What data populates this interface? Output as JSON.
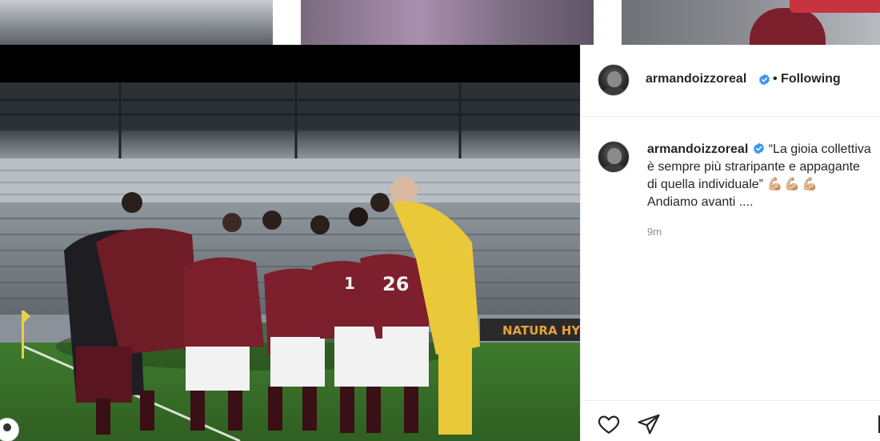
{
  "post": {
    "author": {
      "username": "armandoizzoreal",
      "verified": true,
      "follow_status": "• Following"
    },
    "caption": {
      "username": "armandoizzoreal",
      "lines": [
        "“La gioia collettiva",
        "è sempre più straripante e appagante",
        "di quella individuale”",
        "Andiamo avanti ...."
      ],
      "emoji": "💪🏼💪🏼💪🏼"
    },
    "timestamp": "9m",
    "image": {
      "banner_text": "NATURA HY"
    }
  },
  "icons": {
    "verified": "verified-badge-icon",
    "like": "heart-icon",
    "share": "paper-plane-icon"
  },
  "colors": {
    "verified_blue": "#3897f0",
    "text_primary": "#262626",
    "text_secondary": "#8e8e8e",
    "border": "#efefef",
    "torino_maroon": "#7a1f2b",
    "keeper_yellow": "#e9c83a"
  }
}
